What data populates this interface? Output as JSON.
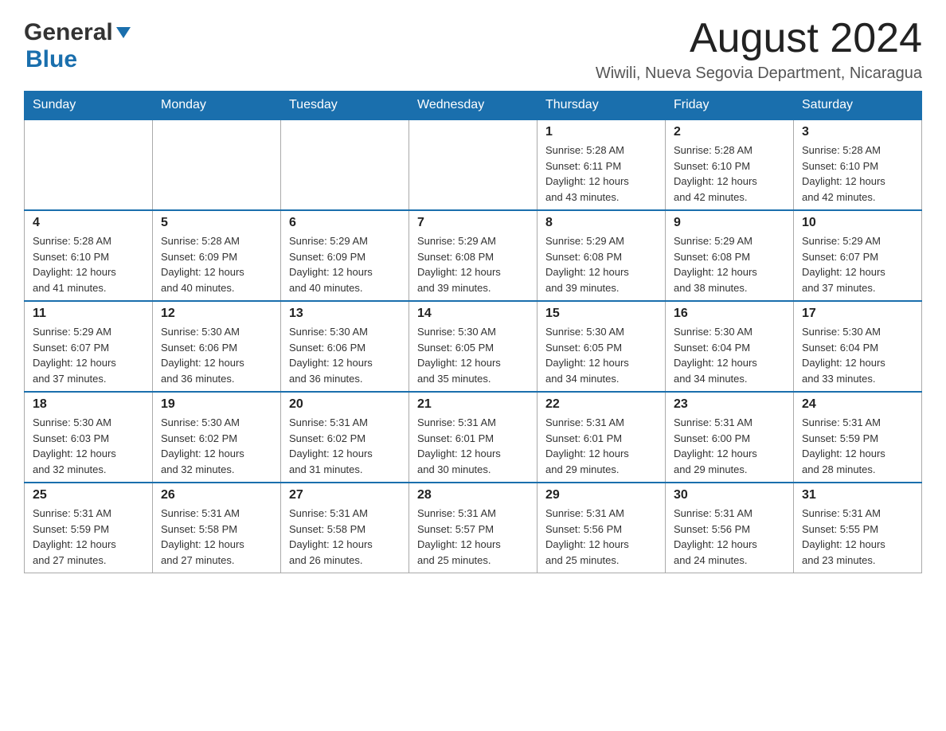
{
  "header": {
    "logo_general": "General",
    "logo_blue": "Blue",
    "month_title": "August 2024",
    "location": "Wiwili, Nueva Segovia Department, Nicaragua"
  },
  "weekdays": [
    "Sunday",
    "Monday",
    "Tuesday",
    "Wednesday",
    "Thursday",
    "Friday",
    "Saturday"
  ],
  "weeks": [
    [
      {
        "day": "",
        "info": ""
      },
      {
        "day": "",
        "info": ""
      },
      {
        "day": "",
        "info": ""
      },
      {
        "day": "",
        "info": ""
      },
      {
        "day": "1",
        "info": "Sunrise: 5:28 AM\nSunset: 6:11 PM\nDaylight: 12 hours\nand 43 minutes."
      },
      {
        "day": "2",
        "info": "Sunrise: 5:28 AM\nSunset: 6:10 PM\nDaylight: 12 hours\nand 42 minutes."
      },
      {
        "day": "3",
        "info": "Sunrise: 5:28 AM\nSunset: 6:10 PM\nDaylight: 12 hours\nand 42 minutes."
      }
    ],
    [
      {
        "day": "4",
        "info": "Sunrise: 5:28 AM\nSunset: 6:10 PM\nDaylight: 12 hours\nand 41 minutes."
      },
      {
        "day": "5",
        "info": "Sunrise: 5:28 AM\nSunset: 6:09 PM\nDaylight: 12 hours\nand 40 minutes."
      },
      {
        "day": "6",
        "info": "Sunrise: 5:29 AM\nSunset: 6:09 PM\nDaylight: 12 hours\nand 40 minutes."
      },
      {
        "day": "7",
        "info": "Sunrise: 5:29 AM\nSunset: 6:08 PM\nDaylight: 12 hours\nand 39 minutes."
      },
      {
        "day": "8",
        "info": "Sunrise: 5:29 AM\nSunset: 6:08 PM\nDaylight: 12 hours\nand 39 minutes."
      },
      {
        "day": "9",
        "info": "Sunrise: 5:29 AM\nSunset: 6:08 PM\nDaylight: 12 hours\nand 38 minutes."
      },
      {
        "day": "10",
        "info": "Sunrise: 5:29 AM\nSunset: 6:07 PM\nDaylight: 12 hours\nand 37 minutes."
      }
    ],
    [
      {
        "day": "11",
        "info": "Sunrise: 5:29 AM\nSunset: 6:07 PM\nDaylight: 12 hours\nand 37 minutes."
      },
      {
        "day": "12",
        "info": "Sunrise: 5:30 AM\nSunset: 6:06 PM\nDaylight: 12 hours\nand 36 minutes."
      },
      {
        "day": "13",
        "info": "Sunrise: 5:30 AM\nSunset: 6:06 PM\nDaylight: 12 hours\nand 36 minutes."
      },
      {
        "day": "14",
        "info": "Sunrise: 5:30 AM\nSunset: 6:05 PM\nDaylight: 12 hours\nand 35 minutes."
      },
      {
        "day": "15",
        "info": "Sunrise: 5:30 AM\nSunset: 6:05 PM\nDaylight: 12 hours\nand 34 minutes."
      },
      {
        "day": "16",
        "info": "Sunrise: 5:30 AM\nSunset: 6:04 PM\nDaylight: 12 hours\nand 34 minutes."
      },
      {
        "day": "17",
        "info": "Sunrise: 5:30 AM\nSunset: 6:04 PM\nDaylight: 12 hours\nand 33 minutes."
      }
    ],
    [
      {
        "day": "18",
        "info": "Sunrise: 5:30 AM\nSunset: 6:03 PM\nDaylight: 12 hours\nand 32 minutes."
      },
      {
        "day": "19",
        "info": "Sunrise: 5:30 AM\nSunset: 6:02 PM\nDaylight: 12 hours\nand 32 minutes."
      },
      {
        "day": "20",
        "info": "Sunrise: 5:31 AM\nSunset: 6:02 PM\nDaylight: 12 hours\nand 31 minutes."
      },
      {
        "day": "21",
        "info": "Sunrise: 5:31 AM\nSunset: 6:01 PM\nDaylight: 12 hours\nand 30 minutes."
      },
      {
        "day": "22",
        "info": "Sunrise: 5:31 AM\nSunset: 6:01 PM\nDaylight: 12 hours\nand 29 minutes."
      },
      {
        "day": "23",
        "info": "Sunrise: 5:31 AM\nSunset: 6:00 PM\nDaylight: 12 hours\nand 29 minutes."
      },
      {
        "day": "24",
        "info": "Sunrise: 5:31 AM\nSunset: 5:59 PM\nDaylight: 12 hours\nand 28 minutes."
      }
    ],
    [
      {
        "day": "25",
        "info": "Sunrise: 5:31 AM\nSunset: 5:59 PM\nDaylight: 12 hours\nand 27 minutes."
      },
      {
        "day": "26",
        "info": "Sunrise: 5:31 AM\nSunset: 5:58 PM\nDaylight: 12 hours\nand 27 minutes."
      },
      {
        "day": "27",
        "info": "Sunrise: 5:31 AM\nSunset: 5:58 PM\nDaylight: 12 hours\nand 26 minutes."
      },
      {
        "day": "28",
        "info": "Sunrise: 5:31 AM\nSunset: 5:57 PM\nDaylight: 12 hours\nand 25 minutes."
      },
      {
        "day": "29",
        "info": "Sunrise: 5:31 AM\nSunset: 5:56 PM\nDaylight: 12 hours\nand 25 minutes."
      },
      {
        "day": "30",
        "info": "Sunrise: 5:31 AM\nSunset: 5:56 PM\nDaylight: 12 hours\nand 24 minutes."
      },
      {
        "day": "31",
        "info": "Sunrise: 5:31 AM\nSunset: 5:55 PM\nDaylight: 12 hours\nand 23 minutes."
      }
    ]
  ]
}
